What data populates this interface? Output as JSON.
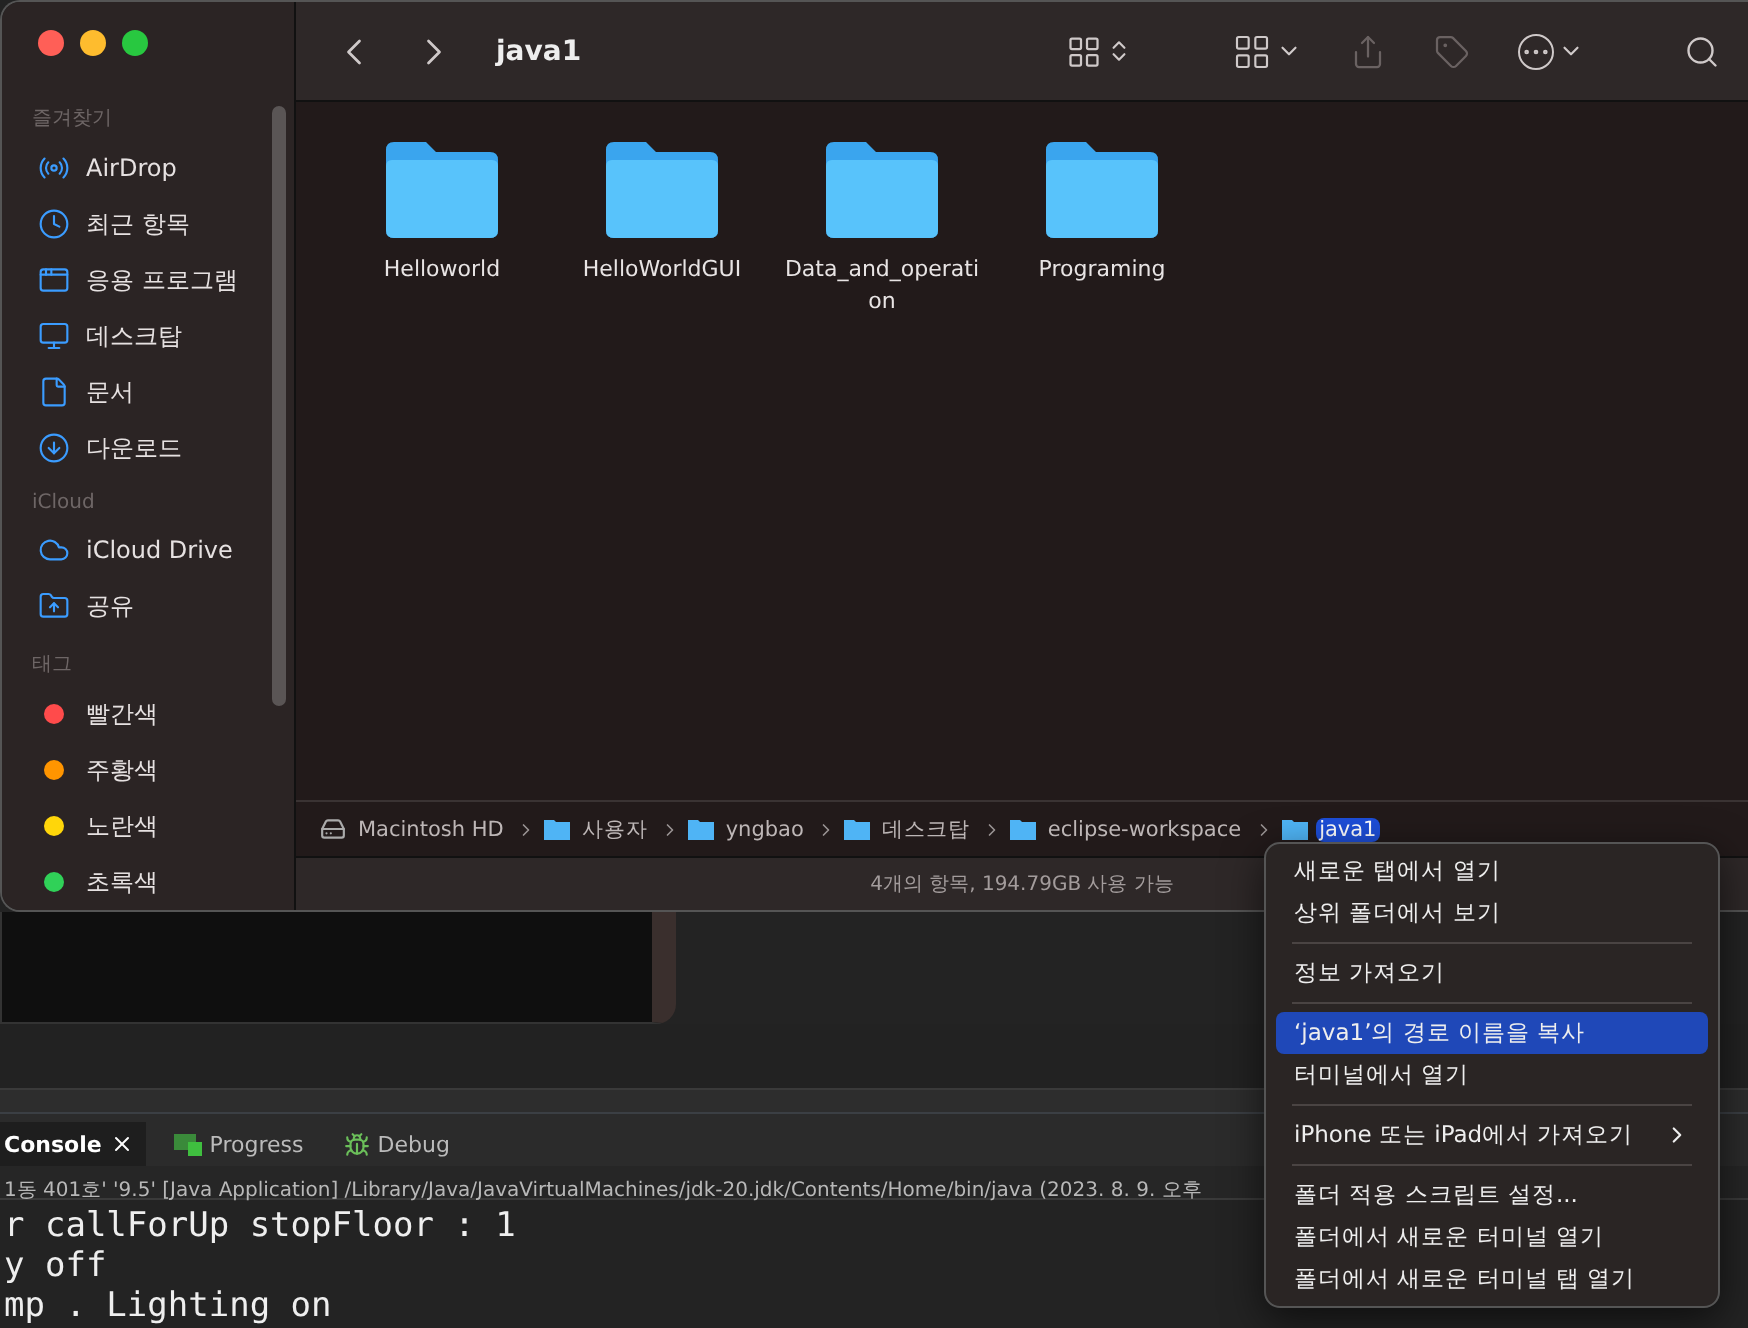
{
  "finder": {
    "title": "java1",
    "sidebar": [
      {
        "heading": "즐겨찾기",
        "items": [
          {
            "label": "AirDrop",
            "kind": "place"
          },
          {
            "label": "최근 항목",
            "kind": "place"
          },
          {
            "label": "응용 프로그램",
            "kind": "place"
          },
          {
            "label": "데스크탑",
            "kind": "place"
          },
          {
            "label": "문서",
            "kind": "place"
          },
          {
            "label": "다운로드",
            "kind": "place"
          }
        ]
      },
      {
        "heading": "iCloud",
        "items": [
          {
            "label": "iCloud Drive",
            "kind": "place"
          },
          {
            "label": "공유",
            "kind": "place"
          }
        ]
      },
      {
        "heading": "태그",
        "items": [
          {
            "label": "빨간색",
            "kind": "tag",
            "color": "#ff4b4b"
          },
          {
            "label": "주황색",
            "kind": "tag",
            "color": "#ff9500"
          },
          {
            "label": "노란색",
            "kind": "tag",
            "color": "#ffd60a"
          },
          {
            "label": "초록색",
            "kind": "tag",
            "color": "#30d158"
          }
        ]
      }
    ],
    "folders": [
      {
        "name": "Helloworld"
      },
      {
        "name": "HelloWorldGUI"
      },
      {
        "name": "Data_and_operati on"
      },
      {
        "name": "Programing"
      }
    ],
    "path": [
      {
        "label": "Macintosh HD",
        "kind": "disk",
        "selected": false
      },
      {
        "label": "사용자",
        "kind": "folder",
        "selected": false
      },
      {
        "label": "yngbao",
        "kind": "folder",
        "selected": false
      },
      {
        "label": "데스크탑",
        "kind": "folder",
        "selected": false
      },
      {
        "label": "eclipse-workspace",
        "kind": "folder",
        "selected": false
      },
      {
        "label": "java1",
        "kind": "folder",
        "selected": true
      }
    ],
    "status": "4개의 항목, 194.79GB 사용 가능"
  },
  "console": {
    "tabs": [
      {
        "label": "Console",
        "selected": true
      },
      {
        "label": "Progress",
        "selected": false
      },
      {
        "label": "Debug",
        "selected": false
      }
    ],
    "launch": "1동 401호' '9.5' [Java Application] /Library/Java/JavaVirtualMachines/jdk-20.jdk/Contents/Home/bin/java  (2023. 8. 9. 오후",
    "lines": [
      "r callForUp stopFloor : 1",
      "y off",
      "mp . Lighting on"
    ]
  },
  "menu": [
    [
      {
        "label": "새로운 탭에서 열기",
        "selected": false
      },
      {
        "label": "상위 폴더에서 보기",
        "selected": false
      }
    ],
    [
      {
        "label": "정보 가져오기",
        "selected": false
      }
    ],
    [
      {
        "label": "‘java1’의 경로 이름을 복사",
        "selected": true
      },
      {
        "label": "터미널에서 열기",
        "selected": false
      }
    ],
    [
      {
        "label": "iPhone 또는 iPad에서 가져오기",
        "selected": false,
        "submenu": true
      }
    ],
    [
      {
        "label": "폴더 적용 스크립트 설정...",
        "selected": false
      },
      {
        "label": "폴더에서 새로운 터미널 열기",
        "selected": false
      },
      {
        "label": "폴더에서 새로운 터미널 탭 열기",
        "selected": false
      }
    ]
  ]
}
